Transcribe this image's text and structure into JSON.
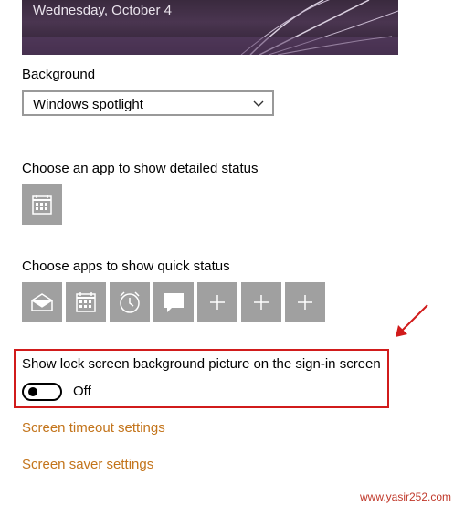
{
  "preview": {
    "date": "Wednesday, October 4"
  },
  "background": {
    "label": "Background",
    "selected": "Windows spotlight"
  },
  "detailed_status": {
    "label": "Choose an app to show detailed status",
    "apps": [
      {
        "icon": "calendar-icon"
      }
    ]
  },
  "quick_status": {
    "label": "Choose apps to show quick status",
    "apps": [
      {
        "icon": "mail-icon"
      },
      {
        "icon": "calendar-icon"
      },
      {
        "icon": "alarm-clock-icon"
      },
      {
        "icon": "message-icon"
      },
      {
        "icon": "plus-icon"
      },
      {
        "icon": "plus-icon"
      },
      {
        "icon": "plus-icon"
      }
    ]
  },
  "signin": {
    "label": "Show lock screen background picture on the sign-in screen",
    "toggle_state": "Off"
  },
  "links": {
    "screen_timeout": "Screen timeout settings",
    "screen_saver": "Screen saver settings"
  },
  "watermark": "www.yasir252.com",
  "colors": {
    "tile": "#a0a0a0",
    "link": "#c3741b",
    "highlight": "#d11b1b"
  }
}
